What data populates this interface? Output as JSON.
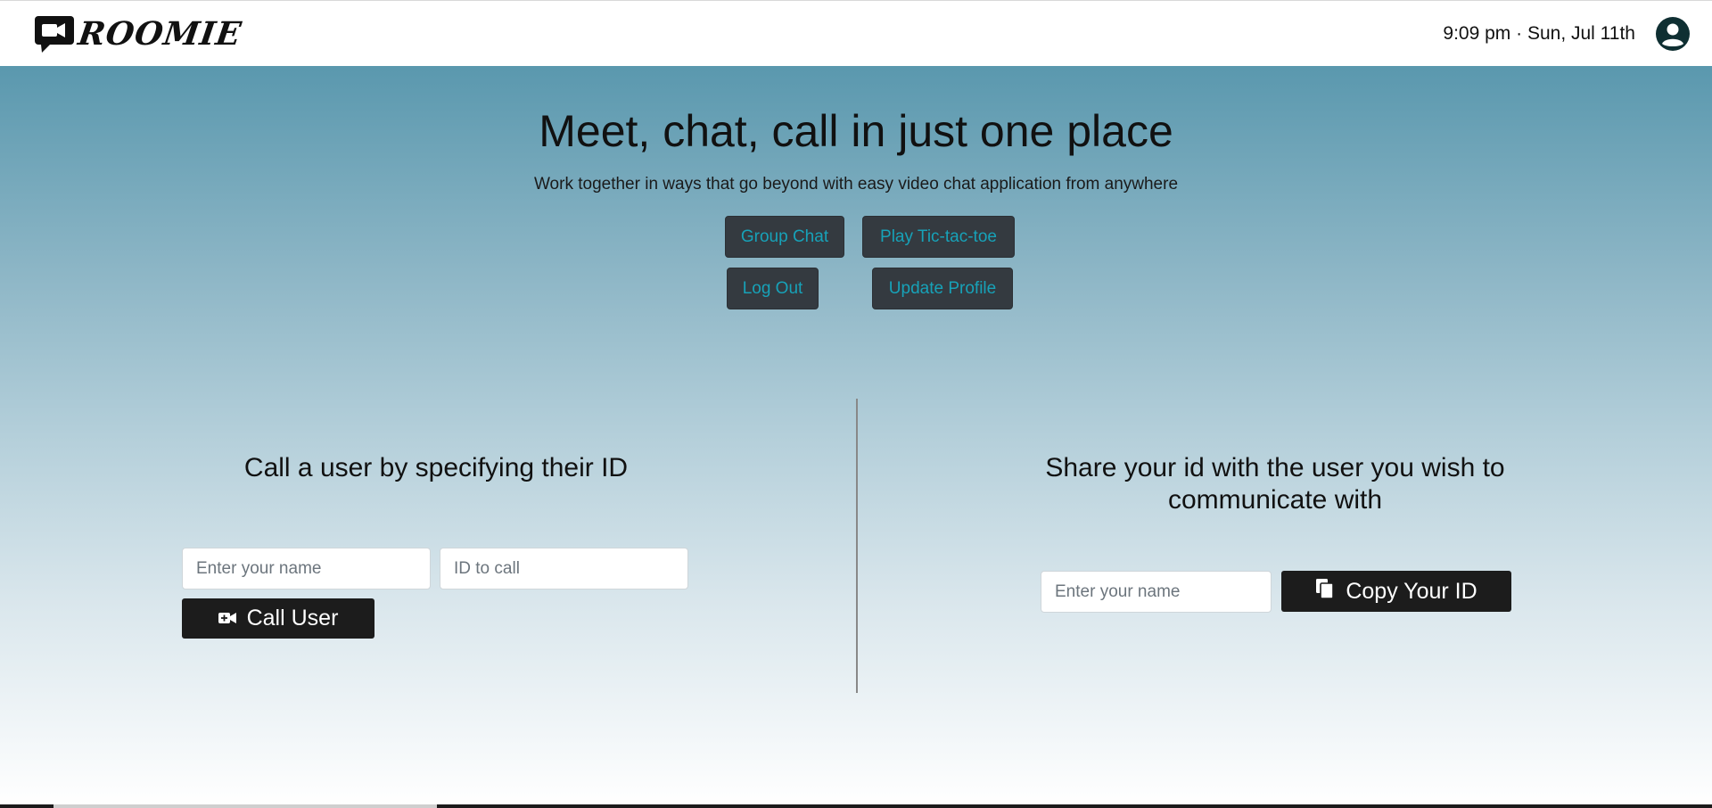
{
  "header": {
    "brand": "ROOMIE",
    "datetime": "9:09 pm · Sun, Jul 11th",
    "icons": {
      "logo": "video-camera-chat-icon",
      "profile": "user-circle-icon"
    }
  },
  "hero": {
    "headline": "Meet, chat, call in just one place",
    "subline": "Work together in ways that go beyond with easy video chat application from anywhere",
    "buttons": {
      "group_chat": "Group Chat",
      "play_tictactoe": "Play Tic-tac-toe",
      "log_out": "Log Out",
      "update_profile": "Update Profile"
    }
  },
  "call_section": {
    "title": "Call a user by specifying their ID",
    "name_placeholder": "Enter your name",
    "id_placeholder": "ID to call",
    "call_button": "Call User",
    "call_icon": "video-plus-icon"
  },
  "share_section": {
    "title_line1": "Share your id with the user you wish to",
    "title_line2": "communicate with",
    "name_placeholder": "Enter your name",
    "copy_button": "Copy Your ID",
    "copy_icon": "copy-icon"
  },
  "colors": {
    "accent": "#17a2b8",
    "dark_button": "#343a40",
    "black_button": "#1c1c1c",
    "gradient_top": "#5a98ae"
  }
}
